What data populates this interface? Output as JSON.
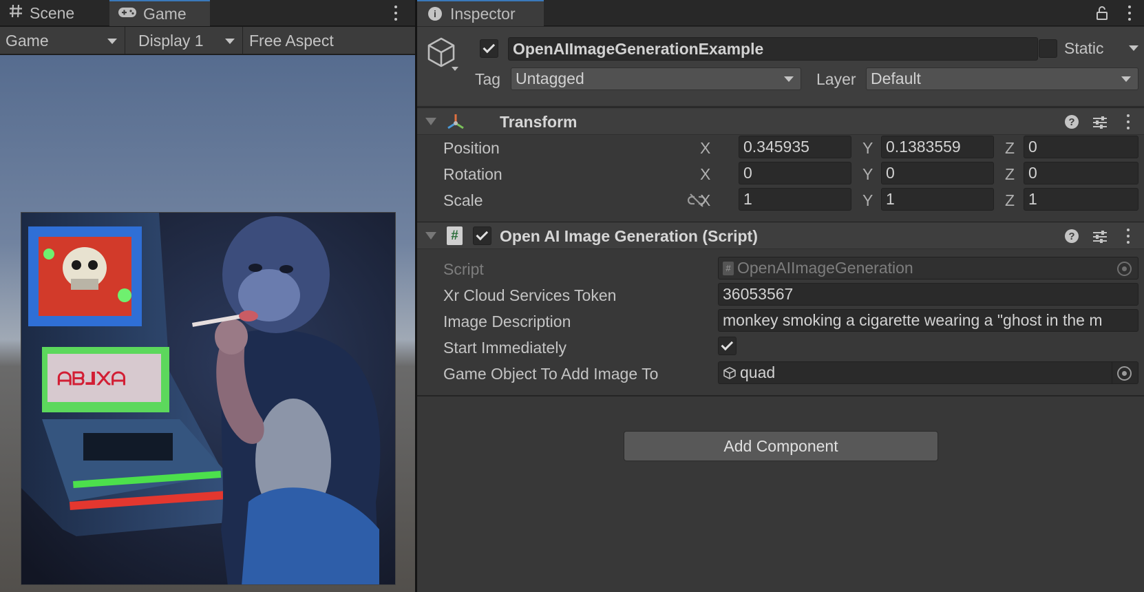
{
  "left_panel": {
    "tabs": [
      {
        "label": "Scene",
        "icon": "hash-grid-icon"
      },
      {
        "label": "Game",
        "icon": "gamepad-icon",
        "active": true
      }
    ],
    "toolbar": {
      "view_dropdown": "Game",
      "display_dropdown": "Display 1",
      "aspect_dropdown": "Free Aspect"
    }
  },
  "inspector": {
    "tab_label": "Inspector",
    "game_object": {
      "active": true,
      "name": "OpenAIImageGenerationExample",
      "static_label": "Static",
      "static": false,
      "tag_label": "Tag",
      "tag_value": "Untagged",
      "layer_label": "Layer",
      "layer_value": "Default"
    },
    "transform": {
      "title": "Transform",
      "rows": [
        {
          "label": "Position",
          "x": "0.345935",
          "y": "0.1383559",
          "z": "0"
        },
        {
          "label": "Rotation",
          "x": "0",
          "y": "0",
          "z": "0"
        },
        {
          "label": "Scale",
          "x": "1",
          "y": "1",
          "z": "1"
        }
      ],
      "axes": [
        "X",
        "Y",
        "Z"
      ]
    },
    "script_component": {
      "title": "Open AI Image Generation (Script)",
      "enabled": true,
      "fields": {
        "script_label": "Script",
        "script_value": "OpenAIImageGeneration",
        "token_label": "Xr Cloud Services Token",
        "token_value": "36053567",
        "description_label": "Image Description",
        "description_value": "monkey smoking a cigarette wearing a \"ghost in the m",
        "start_label": "Start Immediately",
        "start_value": true,
        "target_label": "Game Object To Add Image To",
        "target_value": "quad"
      }
    },
    "add_component_label": "Add Component"
  },
  "colors": {
    "panel_bg": "#383838",
    "header_bg": "#3e3e3e",
    "field_bg": "#2a2a2a",
    "tab_accent": "#3a79bb"
  }
}
